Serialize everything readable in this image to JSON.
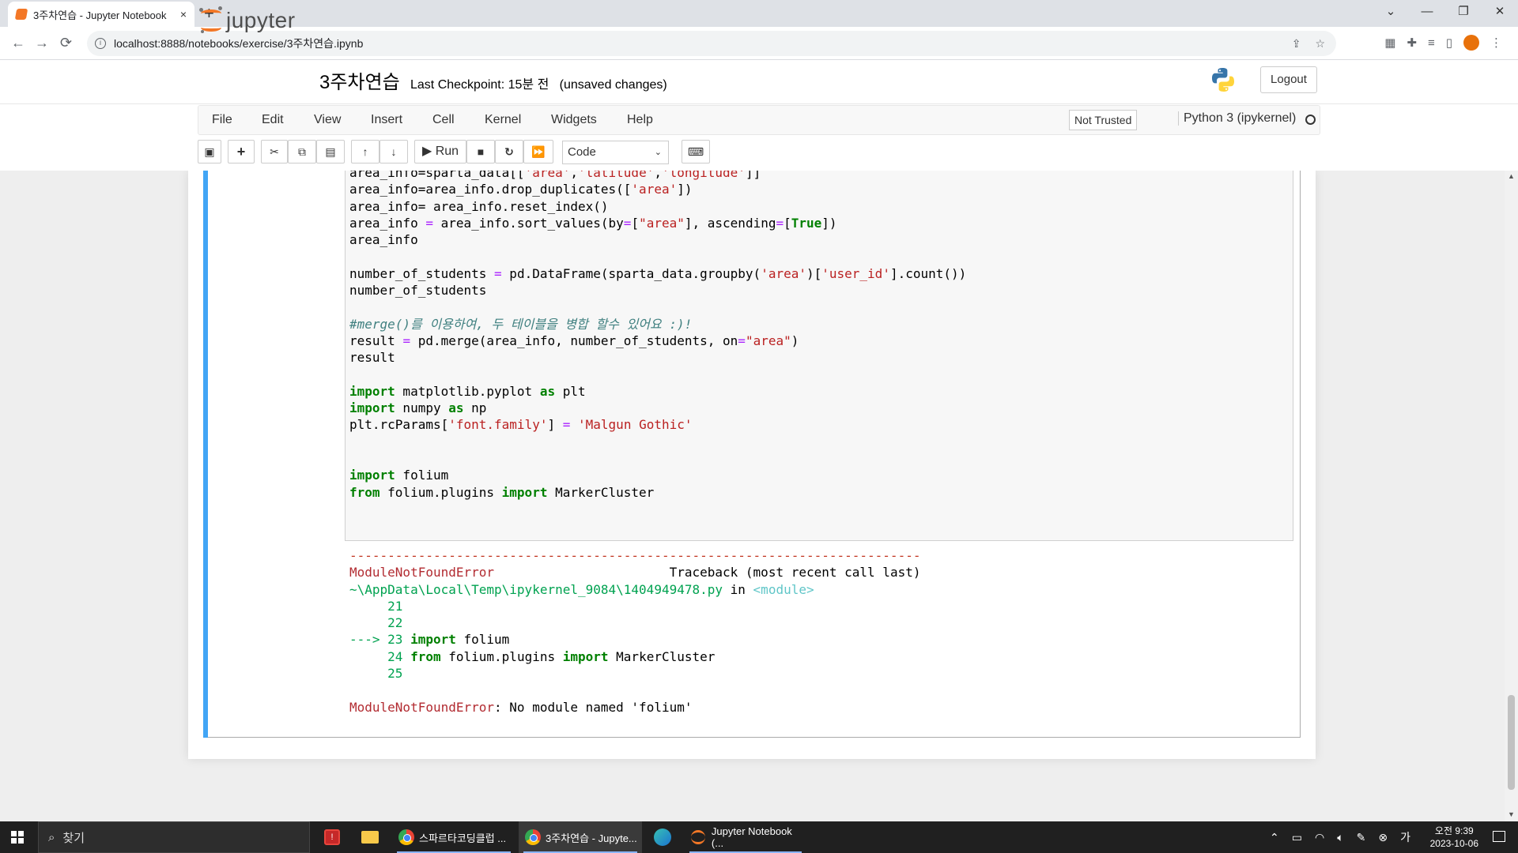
{
  "browser": {
    "tab_title": "3주차연습 - Jupyter Notebook",
    "tab_close": "×",
    "new_tab": "+",
    "url": "localhost:8888/notebooks/exercise/3주차연습.ipynb",
    "window_controls": [
      "⌄",
      "—",
      "❐",
      "✕"
    ]
  },
  "header": {
    "logo_text": "jupyter",
    "notebook_name": "3주차연습",
    "checkpoint": "Last Checkpoint: 15분 전   (unsaved changes)",
    "logout_label": "Logout"
  },
  "menu": {
    "items": [
      "File",
      "Edit",
      "View",
      "Insert",
      "Cell",
      "Kernel",
      "Widgets",
      "Help"
    ],
    "trust_status": "Not Trusted",
    "kernel_name": "Python 3 (ipykernel)"
  },
  "toolbar": {
    "run_label": "Run",
    "cell_type": "Code"
  },
  "taskbar": {
    "search_placeholder": "찾기",
    "apps": [
      {
        "label": "스파르타코딩클럽 ..."
      },
      {
        "label": "3주차연습 - Jupyte..."
      },
      {
        "label": "Jupyter Notebook (..."
      }
    ],
    "time": "오전 9:39",
    "date": "2023-10-06"
  },
  "icons": {
    "toolbar": [
      "save-icon",
      "plus-icon",
      "cut-icon",
      "copy-icon",
      "paste-icon",
      "arrow-up-icon",
      "arrow-down-icon",
      "play-icon",
      "stop-icon",
      "restart-icon",
      "fast-forward-icon",
      "keyboard-icon"
    ]
  },
  "colors": {
    "accent_orange": "#f37726",
    "cell_selected": "#42a5f5",
    "keyword_green": "#008000",
    "string_red": "#ba2121",
    "error_red": "#b22b31"
  }
}
